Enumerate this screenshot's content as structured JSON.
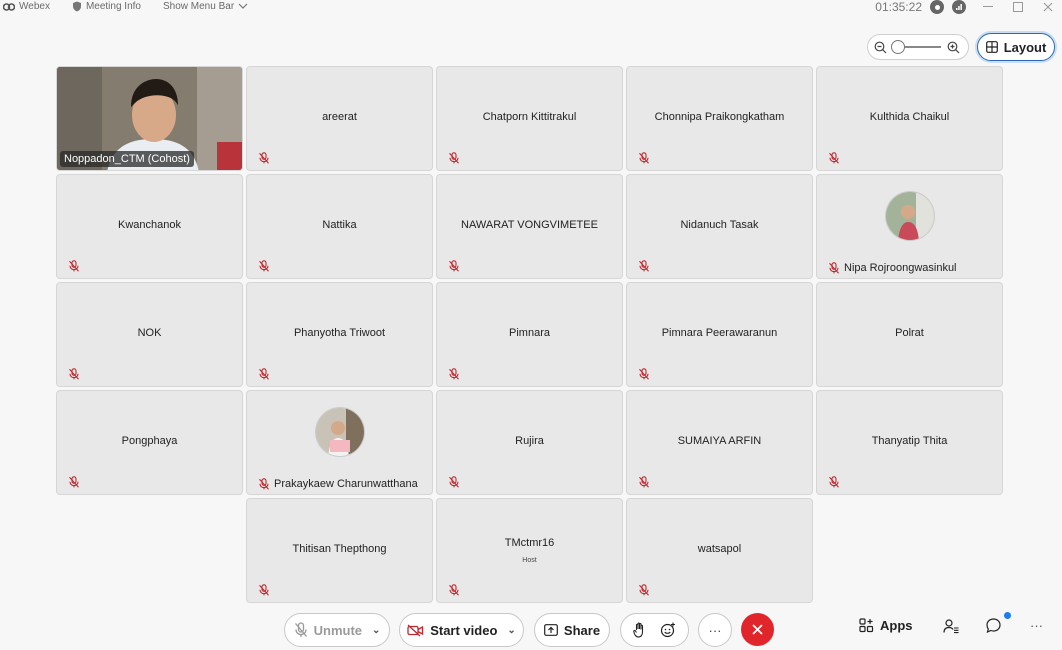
{
  "titlebar": {
    "app_name": "Webex",
    "meeting_info": "Meeting Info",
    "show_menu_bar": "Show Menu Bar",
    "timer": "01:35:22"
  },
  "controls": {
    "layout_label": "Layout"
  },
  "participants": [
    {
      "name": "Noppadon_CTM (Cohost)",
      "video": true
    },
    {
      "name": "areerat"
    },
    {
      "name": "Chatporn Kittitrakul"
    },
    {
      "name": "Chonnipa Praikongkatham"
    },
    {
      "name": "Kulthida Chaikul"
    },
    {
      "name": "Kwanchanok"
    },
    {
      "name": "Nattika"
    },
    {
      "name": "NAWARAT VONGVIMETEE"
    },
    {
      "name": "Nidanuch Tasak"
    },
    {
      "name": "Nipa Rojroongwasinkul",
      "avatar": true
    },
    {
      "name": "NOK"
    },
    {
      "name": "Phanyotha Triwoot"
    },
    {
      "name": "Pimnara"
    },
    {
      "name": "Pimnara Peerawaranun"
    },
    {
      "name": "Polrat",
      "no_mic": true
    },
    {
      "name": "Pongphaya"
    },
    {
      "name": "Prakaykaew Charunwatthana",
      "avatar": true
    },
    {
      "name": "Rujira"
    },
    {
      "name": "SUMAIYA ARFIN"
    },
    {
      "name": "Thanyatip Thita"
    },
    {
      "name": "Thitisan Thepthong"
    },
    {
      "name": "TMctmr16",
      "subtitle": "Host"
    },
    {
      "name": "watsapol"
    }
  ],
  "toolbar": {
    "unmute_label": "Unmute",
    "start_video_label": "Start video",
    "share_label": "Share",
    "more_label": "···",
    "apps_label": "Apps",
    "overflow_label": "···"
  },
  "colors": {
    "accent": "#2b6cb0",
    "end_call": "#e0262b",
    "muted_icon": "#c0272d",
    "notify": "#1d7cf2"
  }
}
